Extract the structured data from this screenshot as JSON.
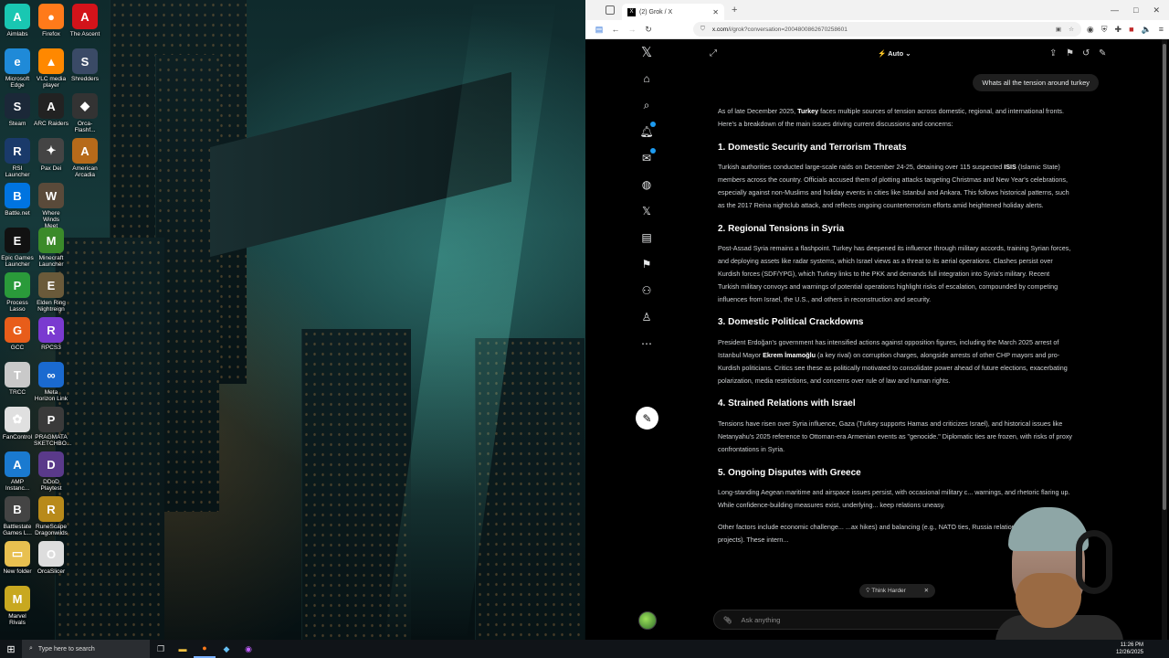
{
  "desktop": {
    "icons": [
      {
        "label": "Aimlabs",
        "glyph": "A",
        "color": "#19c7b2"
      },
      {
        "label": "Firefox",
        "glyph": "●",
        "color": "#ff7a1a"
      },
      {
        "label": "The Ascent",
        "glyph": "A",
        "color": "#d3131a"
      },
      {
        "label": "Microsoft\nEdge",
        "glyph": "e",
        "color": "#1f8ad8"
      },
      {
        "label": "VLC media\nplayer",
        "glyph": "▲",
        "color": "#ff8800"
      },
      {
        "label": "Shredders",
        "glyph": "S",
        "color": "#3a4a66"
      },
      {
        "label": "Steam",
        "glyph": "S",
        "color": "#1b2838"
      },
      {
        "label": "ARC Raiders",
        "glyph": "A",
        "color": "#222"
      },
      {
        "label": "Orca-Flashf...",
        "glyph": "◆",
        "color": "#333"
      },
      {
        "label": "RSI Launcher",
        "glyph": "R",
        "color": "#1a3a6a"
      },
      {
        "label": "Pax Dei",
        "glyph": "✦",
        "color": "#444"
      },
      {
        "label": "American\nArcadia",
        "glyph": "A",
        "color": "#b66a1a"
      },
      {
        "label": "Battle.net",
        "glyph": "B",
        "color": "#0074e0"
      },
      {
        "label": "Where Winds\nMeet",
        "glyph": "W",
        "color": "#5a4a3a"
      },
      {
        "label": "Epic Games\nLauncher",
        "glyph": "E",
        "color": "#111"
      },
      {
        "label": "Minecraft\nLauncher",
        "glyph": "M",
        "color": "#3b8a2a"
      },
      {
        "label": "Process\nLasso",
        "glyph": "P",
        "color": "#2a9a3a"
      },
      {
        "label": "Elden Ring\nNightreign",
        "glyph": "E",
        "color": "#6a5a3a"
      },
      {
        "label": "GCC",
        "glyph": "G",
        "color": "#e85d1a"
      },
      {
        "label": "RPCS3",
        "glyph": "R",
        "color": "#7a3ad0"
      },
      {
        "label": "TRCC",
        "glyph": "T",
        "color": "#c9c9c9"
      },
      {
        "label": "Meta\nHorizon Link",
        "glyph": "∞",
        "color": "#1a6ad0"
      },
      {
        "label": "FanControl",
        "glyph": "✿",
        "color": "#e0e0e0"
      },
      {
        "label": "PRAGMATA\nSKETCHBO...",
        "glyph": "P",
        "color": "#3a3a3a"
      },
      {
        "label": "AMP\nInstanc...",
        "glyph": "A",
        "color": "#1a7ad0"
      },
      {
        "label": "DDoD\nPlaytest",
        "glyph": "D",
        "color": "#5a3a8a"
      },
      {
        "label": "Battlestate\nGames L...",
        "glyph": "B",
        "color": "#444"
      },
      {
        "label": "New folder",
        "glyph": "▭",
        "color": "#e8c050"
      },
      {
        "label": "RuneScape\nDragonwilds",
        "glyph": "R",
        "color": "#b88a1a"
      },
      {
        "label": "Marvel Rivals",
        "glyph": "M",
        "color": "#c8a820"
      },
      {
        "label": "OrcaSlicer",
        "glyph": "O",
        "color": "#ddd"
      }
    ]
  },
  "browser": {
    "tab_title": "(2) Grok / X",
    "url_host": "x.com",
    "url_path": "/i/grok?conversation=2004800862670258601",
    "new_tab": "+",
    "window_controls": [
      "—",
      "□",
      "✕"
    ]
  },
  "xnav": {
    "items": [
      "home-icon",
      "search-icon",
      "bell-icon",
      "mail-icon",
      "grok-icon",
      "x-icon",
      "lists-icon",
      "bookmark-icon",
      "communities-icon",
      "profile-icon",
      "more-icon"
    ]
  },
  "main": {
    "model": "⚡ Auto ⌄",
    "user_message": "Whats all the tension around turkey",
    "intro_pre": "As of late December 2025, ",
    "intro_bold": "Turkey",
    "intro_post": " faces multiple sources of tension across domestic, regional, and international fronts. Here's a breakdown of the main issues driving current discussions and concerns:",
    "s1_title": "1. Domestic Security and Terrorism Threats",
    "s1_pre": "Turkish authorities conducted large-scale raids on December 24-25, detaining over 115 suspected ",
    "s1_bold": "ISIS",
    "s1_post": " (Islamic State) members across the country. Officials accused them of plotting attacks targeting Christmas and New Year's celebrations, especially against non-Muslims and holiday events in cities like Istanbul and Ankara. This follows historical patterns, such as the 2017 Reina nightclub attack, and reflects ongoing counterterrorism efforts amid heightened holiday alerts.",
    "s2_title": "2. Regional Tensions in Syria",
    "s2_text": "Post-Assad Syria remains a flashpoint. Turkey has deepened its influence through military accords, training Syrian forces, and deploying assets like radar systems, which Israel views as a threat to its aerial operations. Clashes persist over Kurdish forces (SDF/YPG), which Turkey links to the PKK and demands full integration into Syria's military. Recent Turkish military convoys and warnings of potential operations highlight risks of escalation, compounded by competing influences from Israel, the U.S., and others in reconstruction and security.",
    "s3_title": "3. Domestic Political Crackdowns",
    "s3_pre": "President Erdoğan's government has intensified actions against opposition figures, including the March 2025 arrest of Istanbul Mayor ",
    "s3_bold": "Ekrem İmamoğlu",
    "s3_post": " (a key rival) on corruption charges, alongside arrests of other CHP mayors and pro-Kurdish politicians. Critics see these as politically motivated to consolidate power ahead of future elections, exacerbating polarization, media restrictions, and concerns over rule of law and human rights.",
    "s4_title": "4. Strained Relations with Israel",
    "s4_text": "Tensions have risen over Syria influence, Gaza (Turkey supports Hamas and criticizes Israel), and historical issues like Netanyahu's 2025 reference to Ottoman-era Armenian events as \"genocide.\" Diplomatic ties are frozen, with risks of proxy confrontations in Syria.",
    "s5_title": "5. Ongoing Disputes with Greece",
    "s5_text": "Long-standing Aegean maritime and airspace issues persist, with occasional military c... warnings, and rhetoric flaring up. While confidence-building measures exist, underlying... keep relations uneasy.",
    "other_text": "Other factors include economic challenge... ...ax hikes) and balancing (e.g., NATO ties, Russia relations via energy projects). These intern...",
    "think_harder": "Think Harder",
    "think_close": "✕",
    "ask_placeholder": "Ask anything"
  },
  "taskbar": {
    "search_placeholder": "Type here to search",
    "time": "11:26 PM",
    "date": "12/26/2025"
  }
}
